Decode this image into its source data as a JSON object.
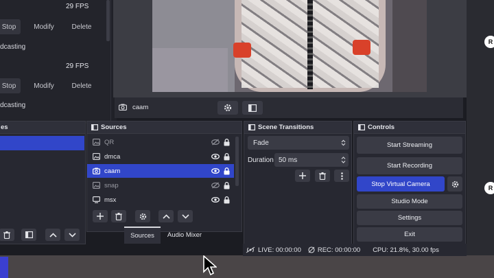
{
  "stats_panel": {
    "rows": [
      {
        "fps": "29 FPS",
        "stop_label": "Stop",
        "modify_label": "Modify",
        "delete_label": "Delete",
        "status": "dcasting"
      },
      {
        "fps": "29 FPS",
        "stop_label": "Stop",
        "modify_label": "Modify",
        "delete_label": "Delete",
        "status": "dcasting"
      }
    ]
  },
  "source_toolbar": {
    "source_name": "caam"
  },
  "scenes": {
    "title": "es"
  },
  "sources": {
    "title": "Sources",
    "items": [
      {
        "name": "QR",
        "type": "image-icon",
        "visible": false,
        "locked": true
      },
      {
        "name": "dmca",
        "type": "image-icon",
        "visible": true,
        "locked": true
      },
      {
        "name": "caam",
        "type": "camera-icon",
        "visible": true,
        "locked": true,
        "selected": true
      },
      {
        "name": "snap",
        "type": "image-icon",
        "visible": false,
        "locked": true
      },
      {
        "name": "msx",
        "type": "monitor-icon",
        "visible": true,
        "locked": true
      }
    ]
  },
  "tabs": {
    "sources": "Sources",
    "audio_mixer": "Audio Mixer"
  },
  "transitions": {
    "title": "Scene Transitions",
    "selected": "Fade",
    "duration_label": "Duration",
    "duration_value": "50 ms"
  },
  "controls": {
    "title": "Controls",
    "start_streaming": "Start Streaming",
    "start_recording": "Start Recording",
    "stop_virtual_camera": "Stop Virtual Camera",
    "studio_mode": "Studio Mode",
    "settings": "Settings",
    "exit": "Exit"
  },
  "status_bar": {
    "live": "LIVE: 00:00:00",
    "rec": "REC: 00:00:00",
    "cpu": "CPU: 21.8%, 30.00 fps"
  },
  "right_badge": "R",
  "colors": {
    "accent": "#3146c9",
    "panel": "#272831",
    "button": "#3a3b45"
  }
}
